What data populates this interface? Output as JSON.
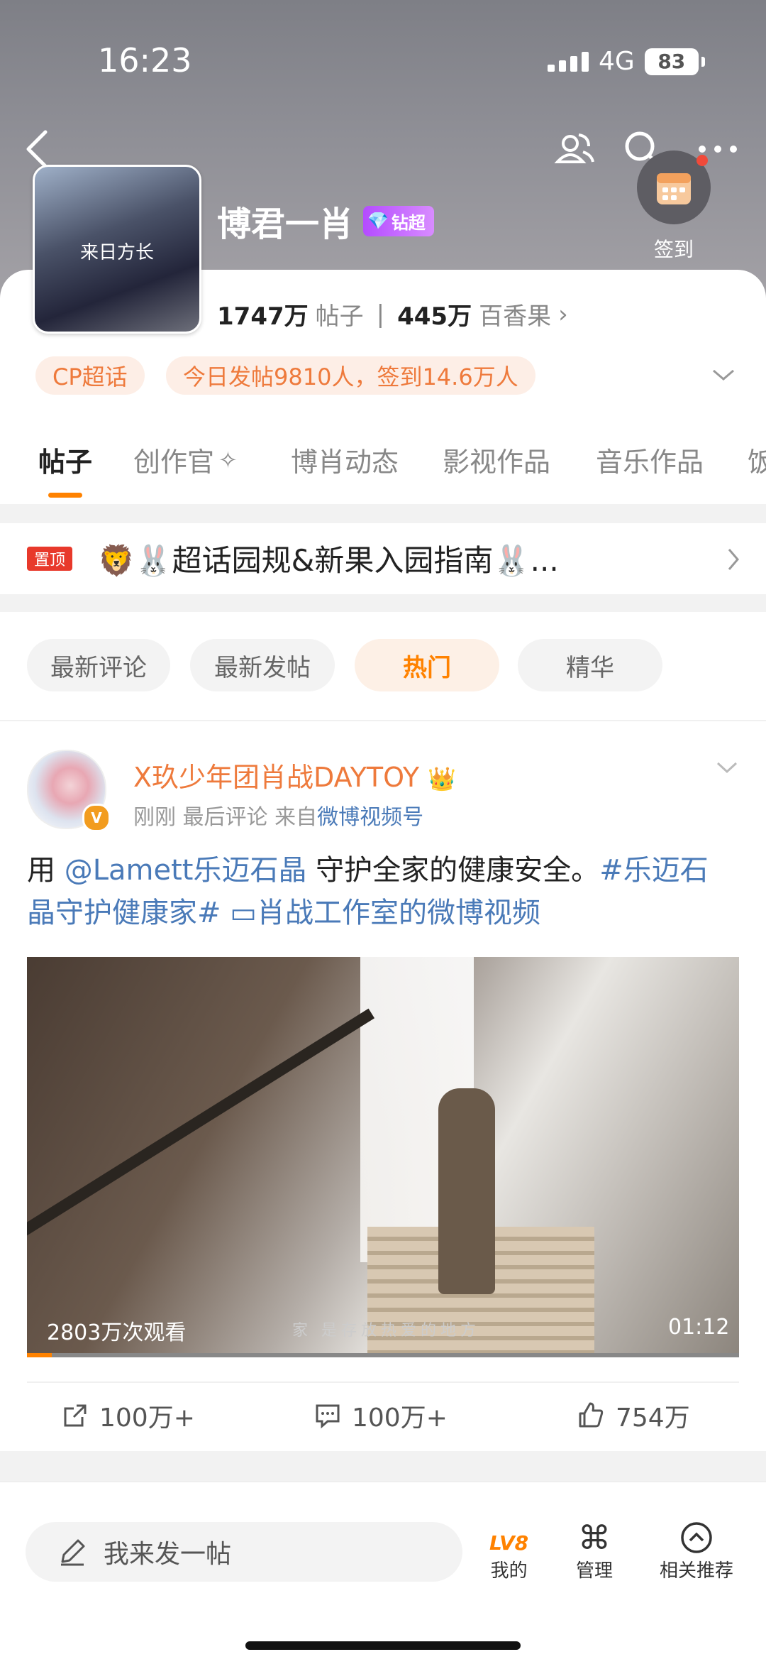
{
  "status": {
    "time": "16:23",
    "network": "4G",
    "battery": "83"
  },
  "header": {
    "title": "博君一肖",
    "badge": "钻超",
    "cover_caption": "来日方长",
    "checkin": "签到"
  },
  "stats": {
    "posts_count": "1747万",
    "posts_label": "帖子",
    "fans_count": "445万",
    "fans_label": "百香果"
  },
  "tags": [
    "CP超话",
    "今日发帖9810人，签到14.6万人"
  ],
  "tabs": [
    "帖子",
    "创作官",
    "博肖动态",
    "影视作品",
    "音乐作品",
    "饭"
  ],
  "pinned": {
    "tag": "置顶",
    "text": "🦁🐰超话园规&新果入园指南🐰..."
  },
  "filters": [
    "最新评论",
    "最新发帖",
    "热门",
    "精华"
  ],
  "post": {
    "author": "X玖少年团肖战DAYTOY",
    "meta_prefix": "刚刚 最后评论  来自",
    "source": "微博视频号",
    "text_1": "用 ",
    "mention": "@Lamett乐迈石晶",
    "text_2": " 守护全家的健康安全。",
    "hashtag": "#乐迈石晶守护健康家#",
    "video_link": "肖战工作室的微博视频",
    "views": "2803万次观看",
    "subtitle": "家 是存放热爱的地方",
    "duration": "01:12",
    "progress": 0.035,
    "reposts": "100万+",
    "comments": "100万+",
    "likes": "754万"
  },
  "bottom": {
    "compose": "我来发一帖",
    "mine": "我的",
    "mine_level": "LV8",
    "manage": "管理",
    "related": "相关推荐"
  }
}
